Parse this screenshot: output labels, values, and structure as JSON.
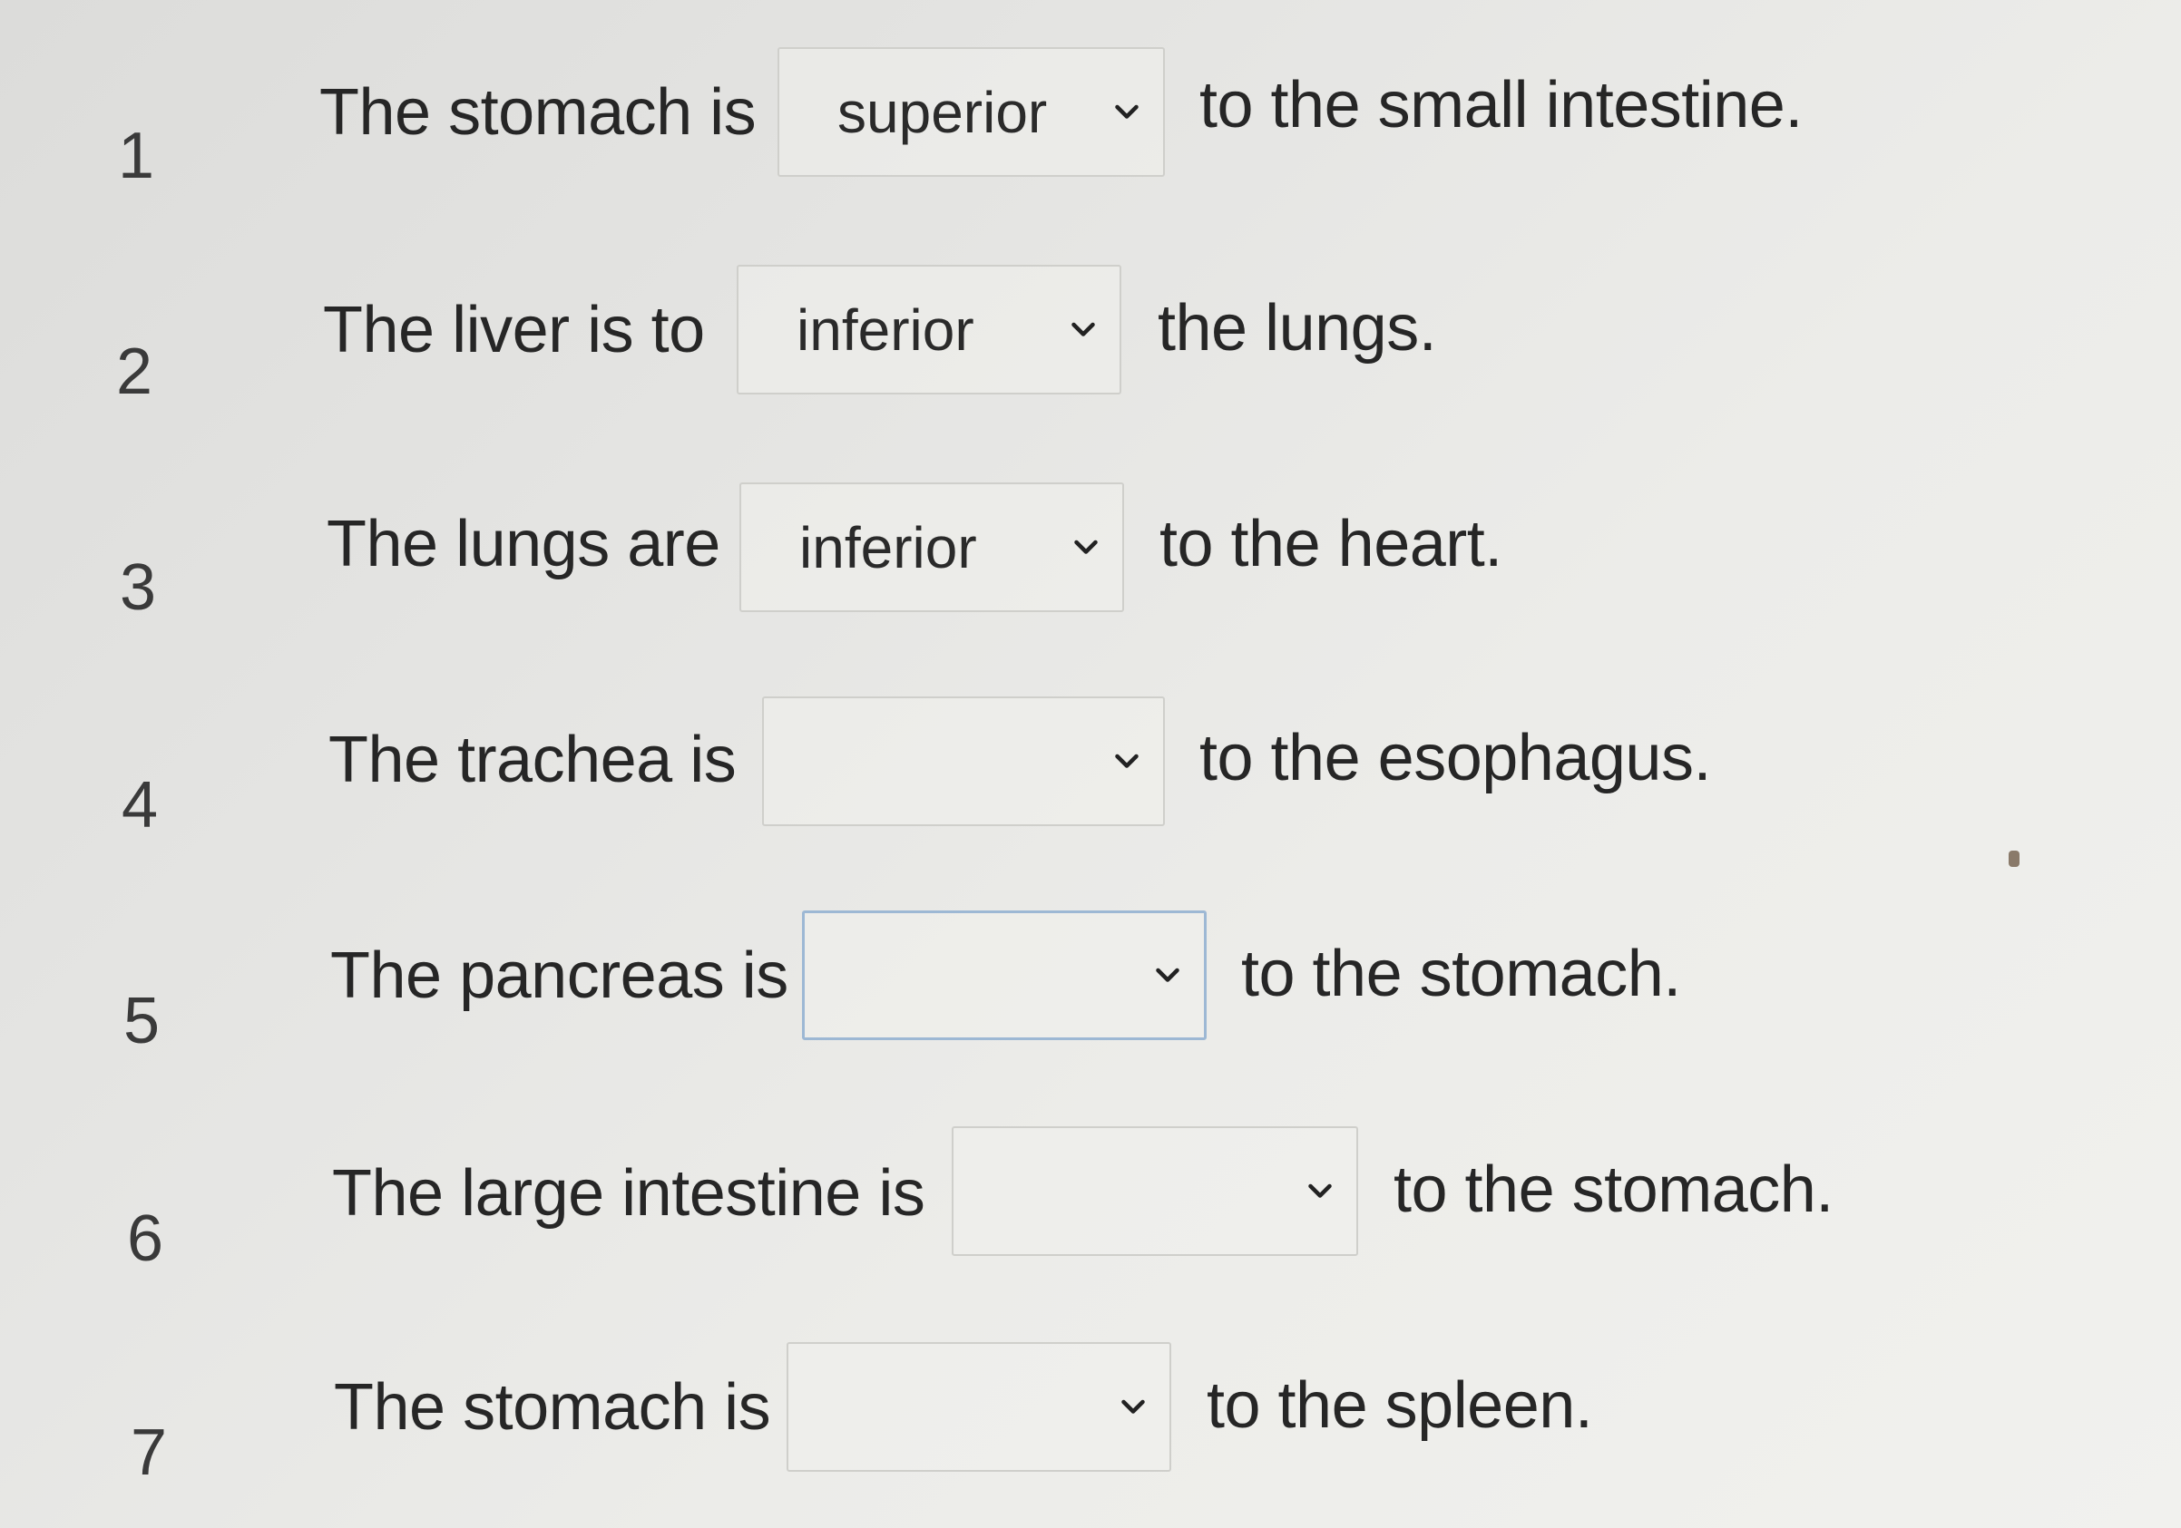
{
  "questions": [
    {
      "number": "1",
      "prefix": "The stomach is",
      "selected": "superior",
      "suffix": "to the small intestine."
    },
    {
      "number": "2",
      "prefix": "The liver is to",
      "selected": "inferior",
      "suffix": "the lungs."
    },
    {
      "number": "3",
      "prefix": "The lungs are",
      "selected": "inferior",
      "suffix": "to the heart."
    },
    {
      "number": "4",
      "prefix": "The trachea is",
      "selected": "",
      "suffix": "to the esophagus."
    },
    {
      "number": "5",
      "prefix": "The pancreas is",
      "selected": "",
      "suffix": "to the stomach."
    },
    {
      "number": "6",
      "prefix": "The large intestine is",
      "selected": "",
      "suffix": "to the stomach."
    },
    {
      "number": "7",
      "prefix": "The stomach is",
      "selected": "",
      "suffix": "to the spleen."
    }
  ],
  "icons": {
    "dropdown": "chevron-down-icon"
  }
}
